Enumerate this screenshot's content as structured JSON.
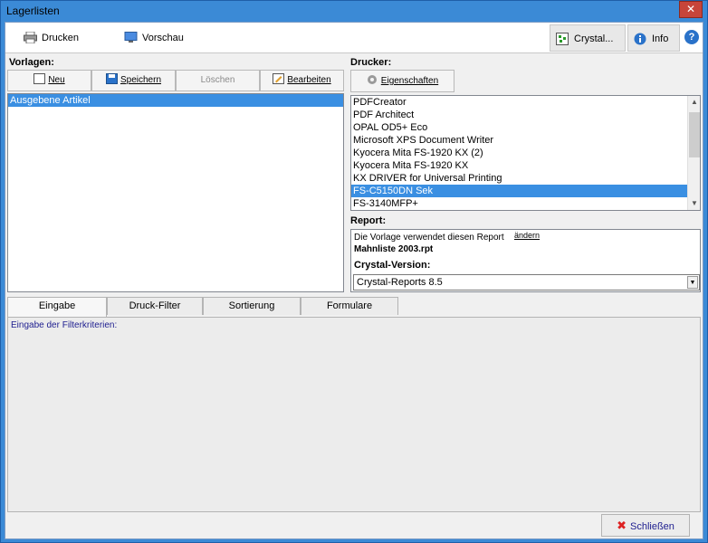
{
  "window": {
    "title": "Lagerlisten",
    "close_glyph": "✕"
  },
  "toolbar": {
    "print_label": "Drucken",
    "preview_label": "Vorschau",
    "crystal_label": "Crystal...",
    "info_label": "Info",
    "help_glyph": "?"
  },
  "vorlagen": {
    "label": "Vorlagen:",
    "buttons": {
      "neu": "Neu",
      "speichern": "Speichern",
      "loeschen": "Löschen",
      "bearbeiten": "Bearbeiten"
    },
    "items": [
      "Ausgebene Artikel"
    ],
    "selected_index": 0
  },
  "drucker": {
    "label": "Drucker:",
    "eigenschaften_label": "Eigenschaften",
    "printers": [
      "PDFCreator",
      "PDF Architect",
      "OPAL OD5+ Eco",
      "Microsoft XPS Document Writer",
      "Kyocera Mita FS-1920 KX (2)",
      "Kyocera Mita FS-1920 KX",
      "KX DRIVER for Universal Printing",
      "FS-C5150DN Sek",
      "FS-3140MFP+"
    ],
    "selected_printer": "FS-C5150DN Sek"
  },
  "report": {
    "label": "Report:",
    "description": "Die Vorlage verwendet diesen Report",
    "change_link": "ändern",
    "file": "Mahnliste 2003.rpt",
    "crystal_version_label": "Crystal-Version:",
    "crystal_version_value": "Crystal-Reports 8.5"
  },
  "tabs": [
    "Eingabe",
    "Druck-Filter",
    "Sortierung",
    "Formulare"
  ],
  "active_tab": "Eingabe",
  "filter_label": "Eingabe der Filterkriterien:",
  "footer": {
    "close_label": "Schließen"
  },
  "colors": {
    "selection": "#3a8fe2",
    "window_frame": "#3b8ad6",
    "link_blue": "#1d1d8f"
  }
}
